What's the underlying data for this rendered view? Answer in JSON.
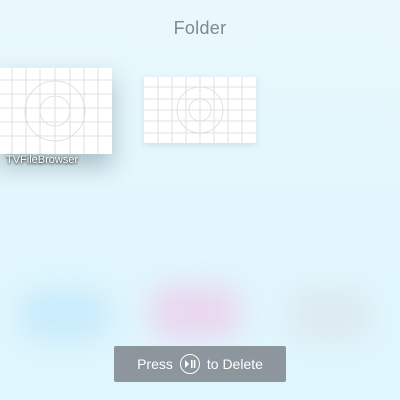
{
  "header": {
    "title": "Folder"
  },
  "items": [
    {
      "label": "TVFileBrowser",
      "focused": true
    },
    {
      "label": "",
      "focused": false
    }
  ],
  "hint": {
    "prefix": "Press",
    "icon": "play-pause-icon",
    "suffix": "to Delete"
  },
  "colors": {
    "background": "#e6f8fc",
    "title": "#7d8a90",
    "hint_background": "#8c969c"
  }
}
